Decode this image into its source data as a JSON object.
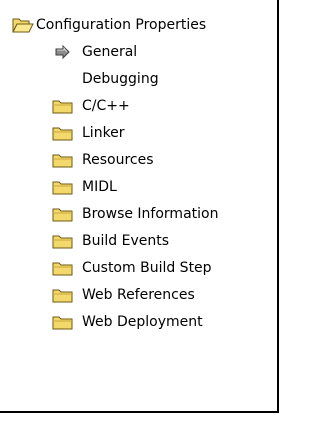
{
  "tree": {
    "root": {
      "label": "Configuration Properties",
      "icon": "open-folder-icon"
    },
    "items": [
      {
        "label": "General",
        "icon": "arrow-right-icon",
        "selected_pointer": true
      },
      {
        "label": "Debugging",
        "icon": "none"
      },
      {
        "label": "C/C++",
        "icon": "folder-icon"
      },
      {
        "label": "Linker",
        "icon": "folder-icon"
      },
      {
        "label": "Resources",
        "icon": "folder-icon"
      },
      {
        "label": "MIDL",
        "icon": "folder-icon"
      },
      {
        "label": "Browse Information",
        "icon": "folder-icon"
      },
      {
        "label": "Build Events",
        "icon": "folder-icon"
      },
      {
        "label": "Custom Build Step",
        "icon": "folder-icon"
      },
      {
        "label": "Web References",
        "icon": "folder-icon"
      },
      {
        "label": "Web Deployment",
        "icon": "folder-icon"
      }
    ]
  },
  "colors": {
    "folder_fill": "#f3d96b",
    "folder_shade": "#c8a93a",
    "folder_outline": "#6e5a16",
    "border": "#000000"
  }
}
